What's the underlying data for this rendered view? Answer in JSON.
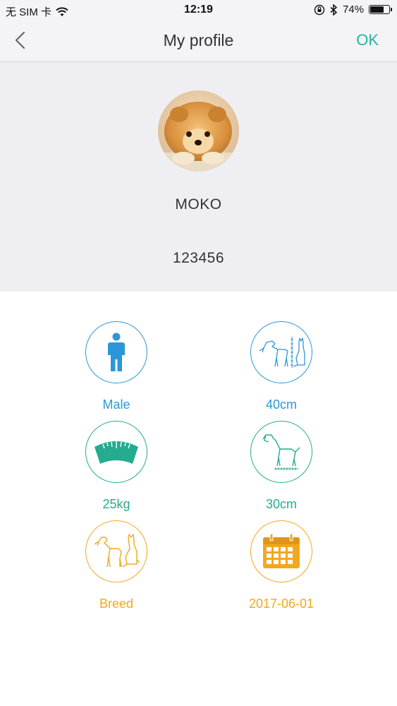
{
  "status_bar": {
    "carrier": "无 SIM 卡",
    "time": "12:19",
    "battery_percent": "74%",
    "battery_level": 0.74
  },
  "nav": {
    "title": "My profile",
    "ok_label": "OK"
  },
  "profile": {
    "name": "MOKO",
    "id": "123456"
  },
  "attributes": [
    {
      "key": "gender",
      "label": "Male",
      "icon": "male-person-icon",
      "color": "#2b97da"
    },
    {
      "key": "height",
      "label": "40cm",
      "icon": "pet-height-icon",
      "color": "#2b97da"
    },
    {
      "key": "weight",
      "label": "25kg",
      "icon": "scale-icon",
      "color": "#25ac8f"
    },
    {
      "key": "length",
      "label": "30cm",
      "icon": "dog-length-icon",
      "color": "#25ac8f"
    },
    {
      "key": "breed",
      "label": "Breed",
      "icon": "dog-cat-icon",
      "color": "#f2a81e"
    },
    {
      "key": "birthday",
      "label": "2017-06-01",
      "icon": "calendar-icon",
      "color": "#f2a81e"
    }
  ]
}
